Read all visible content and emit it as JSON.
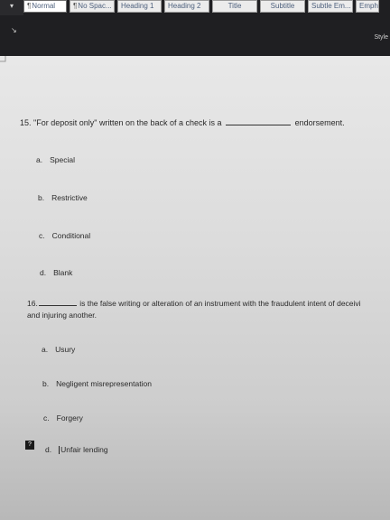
{
  "ribbon": {
    "left_arrow": "▾",
    "styles": [
      {
        "label": "Normal",
        "pmark": "¶",
        "active": true
      },
      {
        "label": "No Spac...",
        "pmark": "¶",
        "active": false
      },
      {
        "label": "Heading 1",
        "pmark": "",
        "active": false
      },
      {
        "label": "Heading 2",
        "pmark": "",
        "active": false
      },
      {
        "label": "Title",
        "pmark": "",
        "active": false
      },
      {
        "label": "Subtitle",
        "pmark": "",
        "active": false
      },
      {
        "label": "Subtle Em...",
        "pmark": "",
        "active": false
      },
      {
        "label": "Emph",
        "pmark": "",
        "active": false
      }
    ],
    "dialog_launcher": "↘",
    "group_label": "Style"
  },
  "document": {
    "q15": {
      "number": "15.",
      "prefix": "\"For deposit only\" written on the back of a check is a",
      "suffix": "endorsement.",
      "options": [
        {
          "letter": "a.",
          "text": "Special"
        },
        {
          "letter": "b.",
          "text": "Restrictive"
        },
        {
          "letter": "c.",
          "text": "Conditional"
        },
        {
          "letter": "d.",
          "text": "Blank"
        }
      ]
    },
    "q16": {
      "number": "16.",
      "line1": "is the false writing or alteration of an instrument with the fraudulent intent of deceivi",
      "line2": "and injuring another.",
      "options": [
        {
          "letter": "a.",
          "text": "Usury"
        },
        {
          "letter": "b.",
          "text": "Negligent misrepresentation"
        },
        {
          "letter": "c.",
          "text": "Forgery"
        },
        {
          "letter": "d.",
          "text": "Unfair lending"
        }
      ]
    },
    "selection_marker": "?"
  }
}
